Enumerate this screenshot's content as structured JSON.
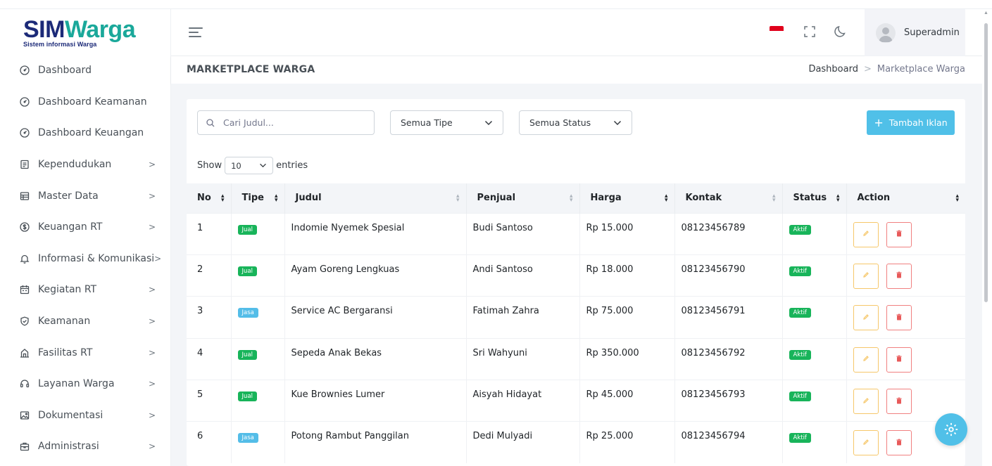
{
  "logo": {
    "main_a": "SIM",
    "main_b": "Warga",
    "subtitle": "Sistem informasi Warga"
  },
  "sidebar": {
    "items": [
      {
        "label": "Dashboard",
        "icon": "dashboard-gauge-icon",
        "has_children": false
      },
      {
        "label": "Dashboard Keamanan",
        "icon": "dashboard-gauge-icon",
        "has_children": false
      },
      {
        "label": "Dashboard Keuangan",
        "icon": "dashboard-gauge-icon",
        "has_children": false
      },
      {
        "label": "Kependudukan",
        "icon": "id-card-icon",
        "has_children": true
      },
      {
        "label": "Master Data",
        "icon": "table-icon",
        "has_children": true
      },
      {
        "label": "Keuangan RT",
        "icon": "money-icon",
        "has_children": true
      },
      {
        "label": "Informasi & Komunikasi",
        "icon": "bell-icon",
        "has_children": true
      },
      {
        "label": "Kegiatan RT",
        "icon": "calendar-icon",
        "has_children": true
      },
      {
        "label": "Keamanan",
        "icon": "shield-icon",
        "has_children": true
      },
      {
        "label": "Fasilitas RT",
        "icon": "building-icon",
        "has_children": true
      },
      {
        "label": "Layanan Warga",
        "icon": "headset-icon",
        "has_children": true
      },
      {
        "label": "Dokumentasi",
        "icon": "image-icon",
        "has_children": true
      },
      {
        "label": "Administrasi",
        "icon": "office-icon",
        "has_children": true
      }
    ],
    "chevron": ">"
  },
  "header": {
    "user_name": "Superadmin"
  },
  "titlebar": {
    "title": "MARKETPLACE WARGA",
    "breadcrumb": {
      "home": "Dashboard",
      "separator": ">",
      "current": "Marketplace Warga"
    }
  },
  "filters": {
    "search_placeholder": "Cari Judul...",
    "tipe_value": "Semua Tipe",
    "status_value": "Semua Status",
    "add_button": "Tambah Iklan",
    "add_plus": "+"
  },
  "entries": {
    "show_label": "Show",
    "value": "10",
    "suffix": "entries"
  },
  "table": {
    "columns": [
      "No",
      "Tipe",
      "Judul",
      "Penjual",
      "Harga",
      "Kontak",
      "Status",
      "Action"
    ],
    "rows": [
      {
        "no": "1",
        "tipe": "Jual",
        "judul": "Indomie Nyemek Spesial",
        "penjual": "Budi Santoso",
        "harga": "Rp 15.000",
        "kontak": "08123456789",
        "status": "Aktif"
      },
      {
        "no": "2",
        "tipe": "Jual",
        "judul": "Ayam Goreng Lengkuas",
        "penjual": "Andi Santoso",
        "harga": "Rp 18.000",
        "kontak": "08123456790",
        "status": "Aktif"
      },
      {
        "no": "3",
        "tipe": "Jasa",
        "judul": "Service AC Bergaransi",
        "penjual": "Fatimah Zahra",
        "harga": "Rp 75.000",
        "kontak": "08123456791",
        "status": "Aktif"
      },
      {
        "no": "4",
        "tipe": "Jual",
        "judul": "Sepeda Anak Bekas",
        "penjual": "Sri Wahyuni",
        "harga": "Rp 350.000",
        "kontak": "08123456792",
        "status": "Aktif"
      },
      {
        "no": "5",
        "tipe": "Jual",
        "judul": "Kue Brownies Lumer",
        "penjual": "Aisyah Hidayat",
        "harga": "Rp 45.000",
        "kontak": "08123456793",
        "status": "Aktif"
      },
      {
        "no": "6",
        "tipe": "Jasa",
        "judul": "Potong Rambut Panggilan",
        "penjual": "Dedi Mulyadi",
        "harga": "Rp 25.000",
        "kontak": "08123456794",
        "status": "Aktif"
      }
    ]
  },
  "colors": {
    "brand_dark": "#1c2a78",
    "brand_teal": "#1aa89a",
    "accent": "#50c0e8",
    "jual_badge": "#18b45a",
    "jasa_badge": "#54bde8",
    "edit_border": "#f6c76a",
    "delete_border": "#f08080"
  }
}
